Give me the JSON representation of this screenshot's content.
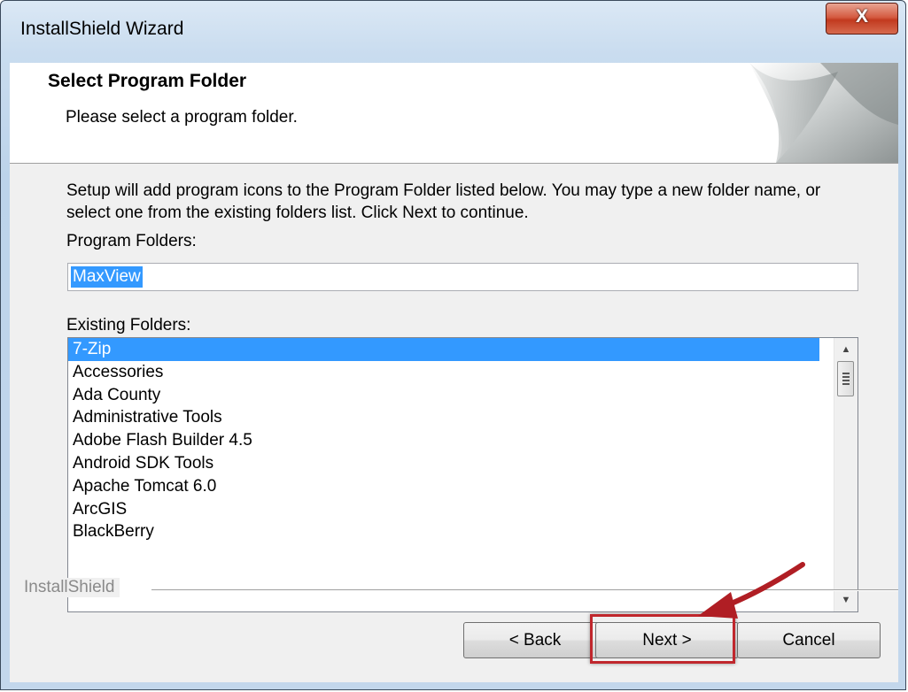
{
  "window": {
    "title": "InstallShield Wizard",
    "close_label": "X"
  },
  "header": {
    "title": "Select Program Folder",
    "subtitle": "Please select a program folder."
  },
  "description": "Setup will add program icons to the Program Folder listed below.  You may type a new folder name, or select one from the existing folders list.  Click Next to continue.",
  "program_folders": {
    "label": "Program Folders:",
    "value": "MaxView"
  },
  "existing_folders": {
    "label": "Existing Folders:",
    "items": [
      "7-Zip",
      "Accessories",
      "Ada County",
      "Administrative Tools",
      "Adobe Flash Builder 4.5",
      "Android SDK Tools",
      "Apache Tomcat 6.0",
      "ArcGIS",
      "BlackBerry"
    ],
    "selected": "7-Zip"
  },
  "brand": "InstallShield",
  "buttons": {
    "back": "< Back",
    "next": "Next >",
    "cancel": "Cancel"
  },
  "colors": {
    "selection": "#3399ff",
    "annotation": "#c0272d"
  },
  "icons": {
    "close": "close-icon",
    "scroll_up": "scroll-up-arrow-icon",
    "scroll_down": "scroll-down-arrow-icon",
    "header_art": "page-curl-graphic"
  }
}
